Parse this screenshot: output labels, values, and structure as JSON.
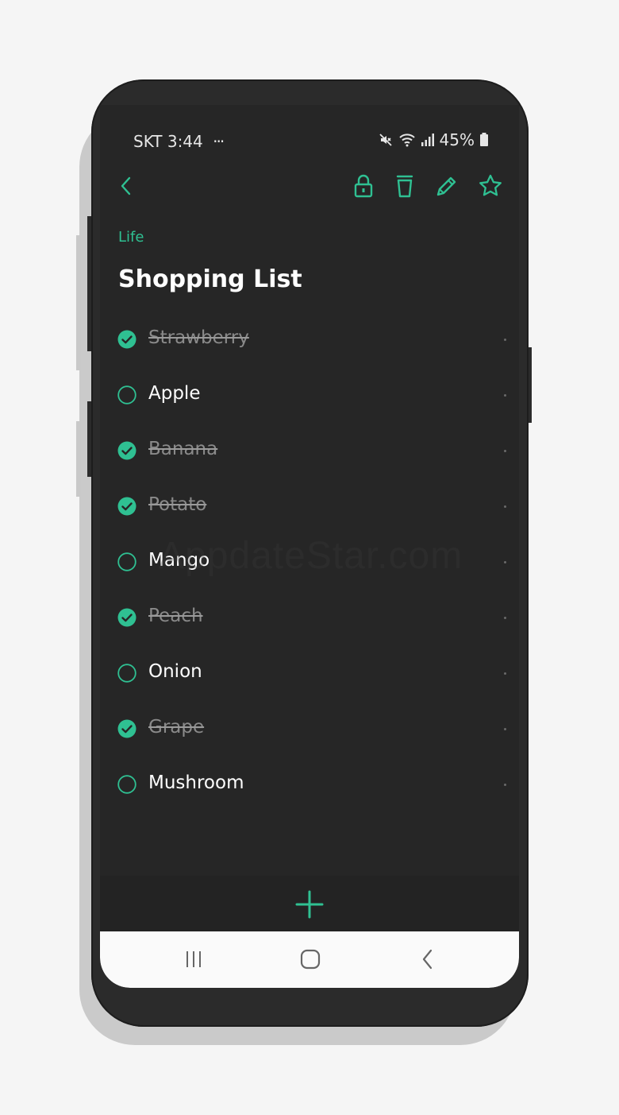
{
  "status_bar": {
    "carrier": "SKT",
    "time": "3:44",
    "more": "···",
    "battery": "45%"
  },
  "toolbar": {
    "icons": [
      "back-icon",
      "lock-icon",
      "trash-icon",
      "pencil-icon",
      "star-icon"
    ]
  },
  "note": {
    "category": "Life",
    "title": "Shopping List"
  },
  "items": [
    {
      "label": "Strawberry",
      "checked": true
    },
    {
      "label": "Apple",
      "checked": false
    },
    {
      "label": "Banana",
      "checked": true
    },
    {
      "label": "Potato",
      "checked": true
    },
    {
      "label": "Mango",
      "checked": false
    },
    {
      "label": "Peach",
      "checked": true
    },
    {
      "label": "Onion",
      "checked": false
    },
    {
      "label": "Grape",
      "checked": true
    },
    {
      "label": "Mushroom",
      "checked": false
    }
  ],
  "watermark": "AppdateStar.com",
  "colors": {
    "accent": "#2fc092",
    "background": "#262626",
    "navbar": "#fafafa"
  }
}
